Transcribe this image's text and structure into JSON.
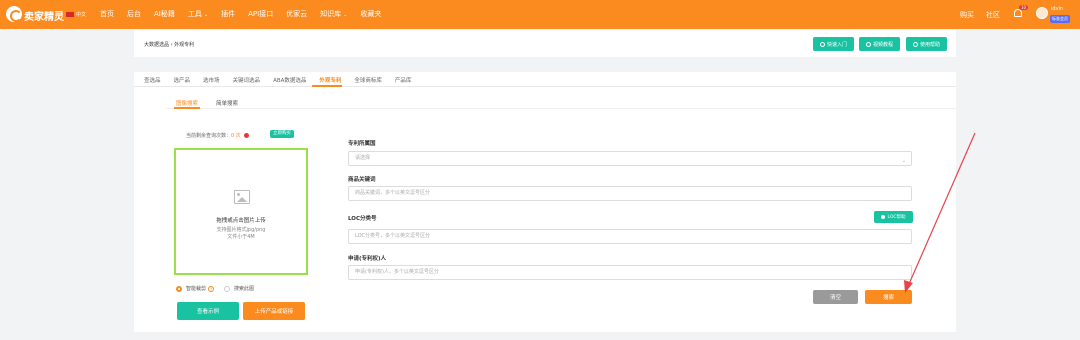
{
  "app": {
    "brand": "卖家精灵",
    "lang": "中文"
  },
  "nav": {
    "items": [
      {
        "label": "首页"
      },
      {
        "label": "后台"
      },
      {
        "label": "AI秘籍"
      },
      {
        "label": "工具",
        "dropdown": true
      },
      {
        "label": "插件"
      },
      {
        "label": "API接口"
      },
      {
        "label": "优家云"
      },
      {
        "label": "知识库",
        "dropdown": true
      },
      {
        "label": "收藏夹"
      }
    ],
    "right": [
      "购买",
      "社区"
    ],
    "notif_count": "10",
    "user": {
      "name": "idvin",
      "badge": "标准会员"
    }
  },
  "header": {
    "breadcrumb": "大数据选品 › 外观专利",
    "buttons": [
      "快速入门",
      "视频教程",
      "使用帮助"
    ]
  },
  "tabs": [
    "查选品",
    "选产品",
    "选市场",
    "关键词选品",
    "ABA数据选品",
    "外观专利",
    "全球商标库",
    "产品库"
  ],
  "active_tab": "外观专利",
  "subtabs": [
    "图像搜索",
    "简单搜索"
  ],
  "active_subtab": "图像搜索",
  "quota": {
    "text": "当前剩余查询次数：",
    "count": "0 次",
    "buy": "立即购买"
  },
  "upload": {
    "title": "拖拽或点击图片上传",
    "sub1": "支持图片格式jpg/png",
    "sub2": "文件小于4M"
  },
  "radios": {
    "opt1": "智能裁剪",
    "opt2": "搜索此图"
  },
  "left_buttons": {
    "example": "查看示例",
    "upload_link": "上传产品或链接"
  },
  "form": {
    "country_label": "专利所属国",
    "country_placeholder": "请选择",
    "keyword_label": "商品关键词",
    "keyword_placeholder": "商品关键词，多个以英文逗号区分",
    "loc_label": "LOC分类号",
    "loc_help": "LOC帮助",
    "loc_placeholder": "LOC分类号，多个以英文逗号区分",
    "applicant_label": "申请(专利权)人",
    "applicant_placeholder": "申请(专利权)人，多个以英文逗号区分",
    "clear": "清空",
    "search": "搜索"
  },
  "colors": {
    "brand": "#fb8a1f",
    "accent": "#19c3a1",
    "annotation": "#e6434b"
  }
}
